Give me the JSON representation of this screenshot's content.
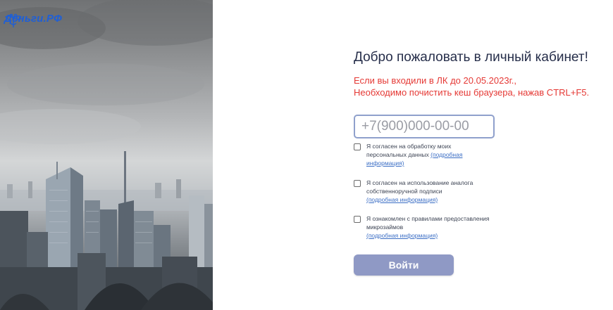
{
  "logo": {
    "text": "Деньги.РФ",
    "icon": "eagle-emblem-icon",
    "color": "#1f5fd6"
  },
  "form": {
    "title": "Добро пожаловать в личный кабинет!",
    "warning_line1": "Если вы входили в ЛК до 20.05.2023г.,",
    "warning_line2": "Необходимо почистить кеш браузера, нажав CTRL+F5.",
    "phone_placeholder": "+7(900)000-00-00",
    "phone_value": "",
    "consents": [
      {
        "text": "Я согласен на обработку моих персональных данных",
        "link": "(подробная информация)",
        "checked": false
      },
      {
        "text": "Я согласен на использование аналога собственноручной подписи",
        "link": "(подробная информация)",
        "checked": false
      },
      {
        "text": "Я ознакомлен с правилами предоставления микрозаймов",
        "link": "(подробная информация)",
        "checked": false
      }
    ],
    "login_label": "Войти"
  },
  "colors": {
    "title": "#262e4a",
    "warning": "#e53935",
    "link": "#3b6ec5",
    "button": "#8f99c5",
    "input_border": "#8fa0cc"
  }
}
